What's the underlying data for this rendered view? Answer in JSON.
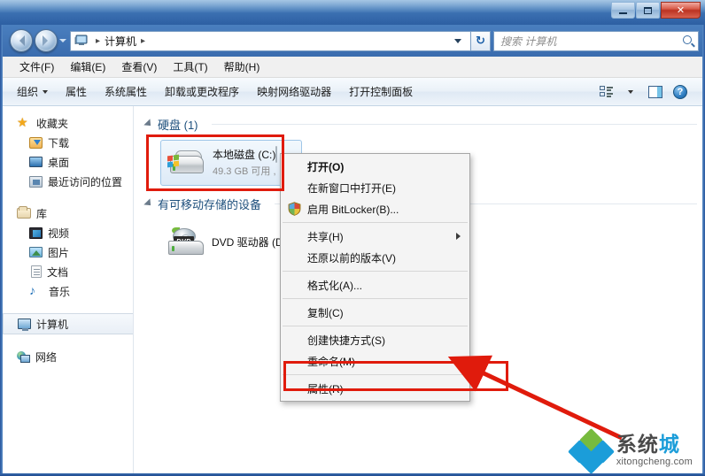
{
  "window": {
    "title": "",
    "controls": {
      "minimize": "",
      "maximize": "",
      "close": "✕"
    }
  },
  "address": {
    "computer_icon": "computer-icon",
    "breadcrumb": [
      "计算机"
    ],
    "separator": "▸",
    "refresh_glyph": "↻"
  },
  "search": {
    "placeholder": "搜索 计算机",
    "value": ""
  },
  "menubar": {
    "items": [
      "文件(F)",
      "编辑(E)",
      "查看(V)",
      "工具(T)",
      "帮助(H)"
    ]
  },
  "toolbar": {
    "organize": "组织",
    "items": [
      "属性",
      "系统属性",
      "卸载或更改程序",
      "映射网络驱动器",
      "打开控制面板"
    ],
    "view_icon": "view-style-icon",
    "preview_icon": "preview-pane-icon",
    "help_icon": "help-icon",
    "help_glyph": "?"
  },
  "navpane": {
    "groups": [
      {
        "header": {
          "label": "收藏夹",
          "icon": "star-icon"
        },
        "items": [
          {
            "label": "下载",
            "icon": "downloads-icon"
          },
          {
            "label": "桌面",
            "icon": "desktop-icon"
          },
          {
            "label": "最近访问的位置",
            "icon": "recent-places-icon"
          }
        ]
      },
      {
        "header": {
          "label": "库",
          "icon": "library-icon"
        },
        "items": [
          {
            "label": "视频",
            "icon": "video-icon"
          },
          {
            "label": "图片",
            "icon": "pictures-icon"
          },
          {
            "label": "文档",
            "icon": "documents-icon"
          },
          {
            "label": "音乐",
            "icon": "music-icon"
          }
        ]
      }
    ],
    "computer": {
      "label": "计算机",
      "icon": "computer-icon",
      "selected": true
    },
    "network": {
      "label": "网络",
      "icon": "network-icon"
    }
  },
  "content": {
    "groups": [
      {
        "title": "硬盘 (1)",
        "drives": [
          {
            "name": "本地磁盘 (C:)",
            "free_text": "49.3 GB 可用 ,",
            "used_percent": 62,
            "icon": "hard-disk-icon",
            "selected": true
          }
        ]
      },
      {
        "title": "有可移动存储的设备",
        "drives": [
          {
            "name": "DVD 驱动器 (D",
            "free_text": "",
            "used_percent": 0,
            "icon": "dvd-drive-icon",
            "selected": false
          }
        ]
      }
    ]
  },
  "context_menu": {
    "items": [
      {
        "label": "打开(O)",
        "bold": true,
        "shield": false,
        "submenu": false
      },
      {
        "label": "在新窗口中打开(E)",
        "bold": false,
        "shield": false,
        "submenu": false
      },
      {
        "label": "启用 BitLocker(B)...",
        "bold": false,
        "shield": true,
        "submenu": false
      },
      {
        "separator": true
      },
      {
        "label": "共享(H)",
        "bold": false,
        "shield": false,
        "submenu": true
      },
      {
        "label": "还原以前的版本(V)",
        "bold": false,
        "shield": false,
        "submenu": false
      },
      {
        "separator": true
      },
      {
        "label": "格式化(A)...",
        "bold": false,
        "shield": false,
        "submenu": false
      },
      {
        "separator": true
      },
      {
        "label": "复制(C)",
        "bold": false,
        "shield": false,
        "submenu": false
      },
      {
        "separator": true
      },
      {
        "label": "创建快捷方式(S)",
        "bold": false,
        "shield": false,
        "submenu": false
      },
      {
        "label": "重命名(M)",
        "bold": false,
        "shield": false,
        "submenu": false
      },
      {
        "separator": true
      },
      {
        "label": "属性(R)",
        "bold": false,
        "shield": false,
        "submenu": false
      }
    ]
  },
  "annotations": {
    "color": "#e01b0c",
    "highlight_drive": "本地磁盘 (C:)",
    "highlight_menu_item": "属性(R)",
    "arrow": "points-to-properties"
  },
  "watermark": {
    "cn_left": "系统",
    "cn_right": "城",
    "en": "xitongcheng.com",
    "logo": "diamond-logo",
    "colors": {
      "green": "#77bb3e",
      "blue": "#1b9dd9",
      "grey": "#4a4a4a"
    }
  }
}
